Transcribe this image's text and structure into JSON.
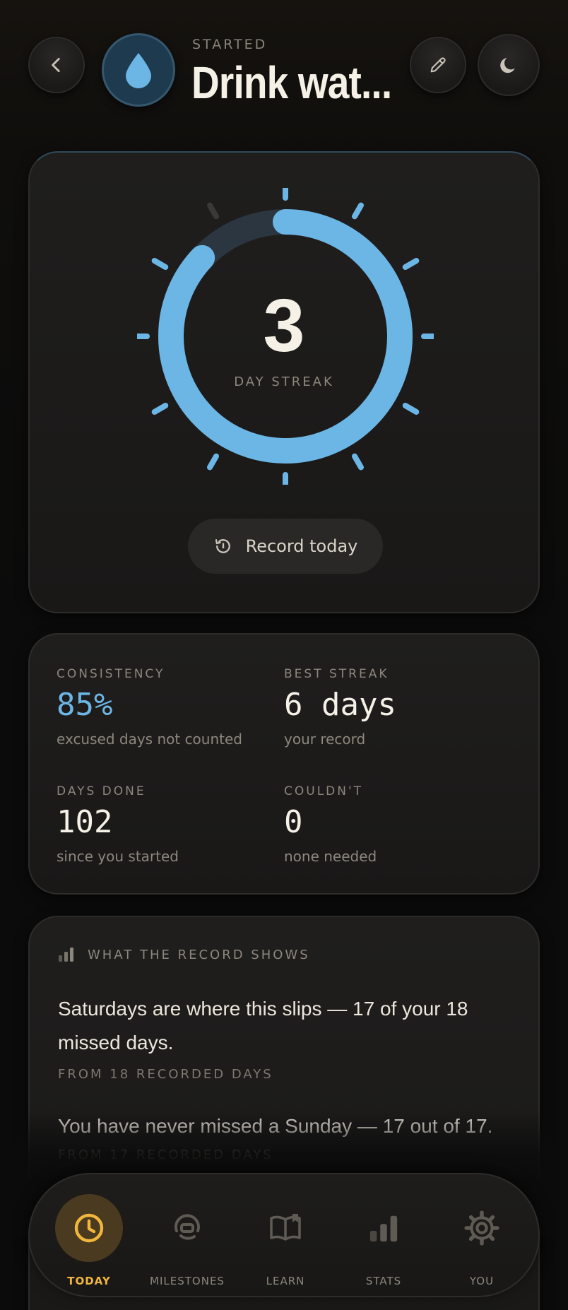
{
  "header": {
    "status": "STARTED",
    "title": "Drink wat...",
    "icons": {
      "back": "chevron-left-icon",
      "habit": "water-drop-icon",
      "edit": "pencil-icon",
      "theme": "moon-icon"
    }
  },
  "streak": {
    "count": "3",
    "label": "DAY STREAK",
    "progress_fraction": 0.87,
    "record_button": "Record today"
  },
  "stats": {
    "consistency": {
      "label": "CONSISTENCY",
      "value": "85%",
      "sub": "excused days not counted"
    },
    "best_streak": {
      "label": "BEST STREAK",
      "value": "6 days",
      "sub": "your record"
    },
    "days_done": {
      "label": "DAYS DONE",
      "value": "102",
      "sub": "since you started"
    },
    "couldnt": {
      "label": "COULDN'T",
      "value": "0",
      "sub": "none needed"
    }
  },
  "insights": {
    "heading": "WHAT THE RECORD SHOWS",
    "items": [
      {
        "text": "Saturdays are where this slips — 17 of your 18 missed days.",
        "source": "FROM 18 RECORDED DAYS"
      },
      {
        "text": "You have never missed a Sunday — 17 out of 17.",
        "source": "FROM 17 RECORDED DAYS"
      }
    ]
  },
  "nav": {
    "items": [
      {
        "label": "TODAY",
        "icon": "clock-icon",
        "active": true
      },
      {
        "label": "MILESTONES",
        "icon": "milestones-icon",
        "active": false
      },
      {
        "label": "LEARN",
        "icon": "book-icon",
        "active": false
      },
      {
        "label": "STATS",
        "icon": "bar-chart-icon",
        "active": false
      },
      {
        "label": "YOU",
        "icon": "gear-icon",
        "active": false
      }
    ]
  },
  "colors": {
    "accent_blue": "#6cb6e6",
    "accent_gold": "#f2b63d",
    "background": "#0b0b0b",
    "card": "#1d1c1b"
  }
}
